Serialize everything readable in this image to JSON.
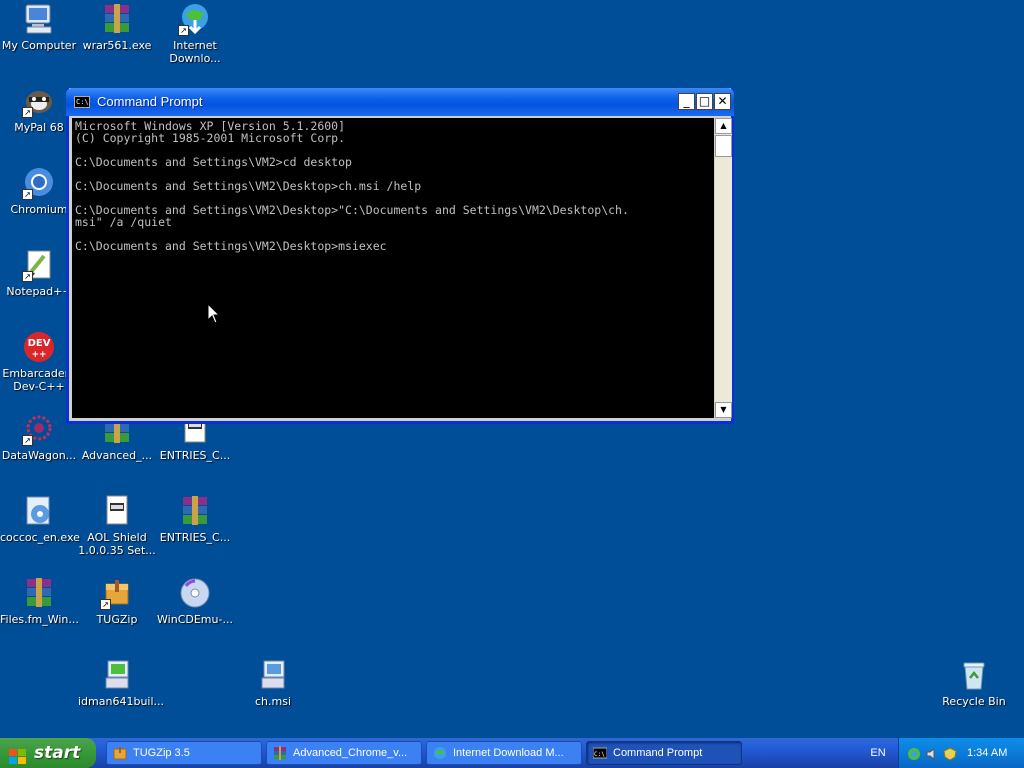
{
  "desktop": {
    "icons": [
      {
        "label": "My Computer",
        "icon": "computer-icon"
      },
      {
        "label": "wrar561.exe",
        "icon": "winrar-icon"
      },
      {
        "label": "Internet\nDownlo...",
        "icon": "idm-icon"
      },
      {
        "label": "MyPal 68",
        "icon": "mypal-icon"
      },
      {
        "label": "Chromium",
        "icon": "chromium-icon"
      },
      {
        "label": "Notepad++",
        "icon": "notepad-icon"
      },
      {
        "label": "Embarcadero\nDev-C++",
        "icon": "devcpp-icon"
      },
      {
        "label": "DataWagon...",
        "icon": "datawagon-icon"
      },
      {
        "label": "Advanced_...",
        "icon": "winrar-icon"
      },
      {
        "label": "ENTRIES_C...",
        "icon": "msi-icon"
      },
      {
        "label": "coccoc_en.exe",
        "icon": "installer-icon"
      },
      {
        "label": "AOL Shield\n1.0.0.35 Set...",
        "icon": "msi-icon"
      },
      {
        "label": "ENTRIES_C...",
        "icon": "winrar-icon"
      },
      {
        "label": "Files.fm_Win...",
        "icon": "winrar-icon"
      },
      {
        "label": "TUGZip",
        "icon": "tugzip-icon"
      },
      {
        "label": "WinCDEmu-...",
        "icon": "cd-icon"
      },
      {
        "label": "idman641buil...",
        "icon": "installer-icon"
      },
      {
        "label": "ch.msi",
        "icon": "installer-icon"
      },
      {
        "label": "Recycle Bin",
        "icon": "recycle-bin-icon"
      }
    ]
  },
  "window": {
    "title": "Command Prompt",
    "icon_text": "C:\\",
    "minimize": "_",
    "maximize": "□",
    "close": "✕",
    "console_lines": [
      "Microsoft Windows XP [Version 5.1.2600]",
      "(C) Copyright 1985-2001 Microsoft Corp.",
      "",
      "C:\\Documents and Settings\\VM2>cd desktop",
      "",
      "C:\\Documents and Settings\\VM2\\Desktop>ch.msi /help",
      "",
      "C:\\Documents and Settings\\VM2\\Desktop>\"C:\\Documents and Settings\\VM2\\Desktop\\ch.",
      "msi\" /a /quiet",
      "",
      "C:\\Documents and Settings\\VM2\\Desktop>msiexec"
    ],
    "scroll_up": "▲",
    "scroll_down": "▼"
  },
  "taskbar": {
    "start_label": "start",
    "tasks": [
      {
        "label": "TUGZip 3.5",
        "icon": "tugzip-icon",
        "active": false
      },
      {
        "label": "Advanced_Chrome_v...",
        "icon": "winrar-icon",
        "active": false
      },
      {
        "label": "Internet Download M...",
        "icon": "idm-icon",
        "active": false
      },
      {
        "label": "Command Prompt",
        "icon": "cmd-icon",
        "active": true
      }
    ],
    "language": "EN",
    "clock": "1:34 AM"
  }
}
